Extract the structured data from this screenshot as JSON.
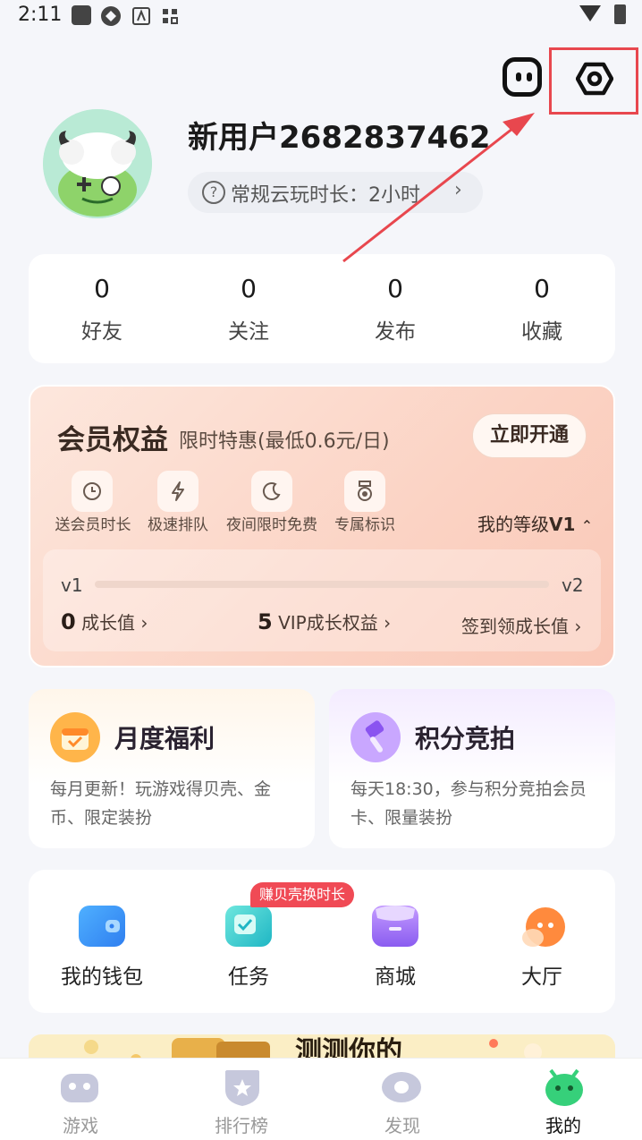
{
  "status_bar": {
    "time": "2:11"
  },
  "profile": {
    "username": "新用户2682837462",
    "playtime_label": "常规云玩时长：2小时",
    "playtime_arrow": "›"
  },
  "stats": [
    {
      "value": "0",
      "label": "好友"
    },
    {
      "value": "0",
      "label": "关注"
    },
    {
      "value": "0",
      "label": "发布"
    },
    {
      "value": "0",
      "label": "收藏"
    }
  ],
  "vip": {
    "title": "会员权益",
    "subtitle": "限时特惠(最低0.6元/日)",
    "open_button": "立即开通",
    "perks": [
      "送会员时长",
      "极速排队",
      "夜间限时免费",
      "专属标识"
    ],
    "my_level_label": "我的等级",
    "my_level_value": "V1",
    "level_from": "v1",
    "level_to": "v2",
    "progress_fraction": 0.0,
    "growth_value": "0",
    "growth_label": "成长值",
    "vip_growth_value": "5",
    "vip_growth_label": "VIP成长权益",
    "checkin_label": "签到领成长值",
    "arrow": "›",
    "collapse": "⌃"
  },
  "promos": [
    {
      "title": "月度福利",
      "desc": "每月更新！玩游戏得贝壳、金币、限定装扮",
      "icon": "calendar-gift-icon"
    },
    {
      "title": "积分竞拍",
      "desc": "每天18:30，参与积分竞拍会员卡、限量装扮",
      "icon": "auction-hammer-icon"
    }
  ],
  "shortcuts": [
    {
      "label": "我的钱包",
      "icon": "wallet-icon",
      "color": "#2f8ff5"
    },
    {
      "label": "任务",
      "icon": "task-icon",
      "color": "#2ec4c9",
      "badge": "赚贝壳换时长"
    },
    {
      "label": "商城",
      "icon": "shop-icon",
      "color": "#8a5cf0"
    },
    {
      "label": "大厅",
      "icon": "lobby-icon",
      "color": "#ff7a3d"
    }
  ],
  "banner": {
    "text": "测测你的"
  },
  "bottom_nav": [
    {
      "label": "游戏",
      "icon": "gamepad-icon",
      "active": false
    },
    {
      "label": "排行榜",
      "icon": "ranking-icon",
      "active": false
    },
    {
      "label": "发现",
      "icon": "discover-icon",
      "active": false
    },
    {
      "label": "我的",
      "icon": "profile-monster-icon",
      "active": true
    }
  ],
  "colors": {
    "highlight": "#e8474e",
    "accent_green": "#36d07a"
  }
}
